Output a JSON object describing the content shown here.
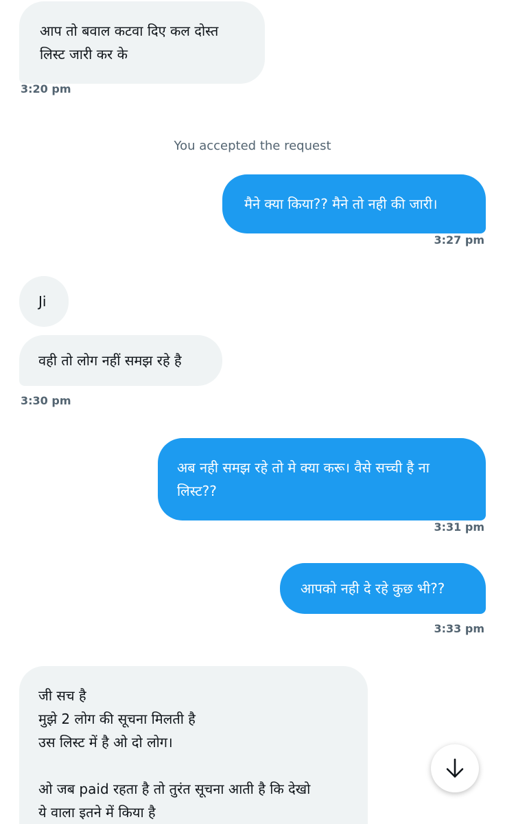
{
  "messages": [
    {
      "text": "आप तो बवाल कटवा दिए कल दोस्त\nलिस्ट जारी कर के"
    },
    {
      "text": "मैने क्या किया?? मैने तो नही की जारी।"
    },
    {
      "text": "Ji"
    },
    {
      "text": "वही तो लोग नहीं समझ रहे है"
    },
    {
      "text": "अब नही समझ रहे तो मे क्या करू। वैसे सच्ची है ना\nलिस्ट??"
    },
    {
      "text": "आपको नही दे रहे कुछ भी??"
    },
    {
      "text": "जी सच है\nमुझे 2 लोग की सूचना मिलती है\n उस लिस्ट में है ओ दो लोग।\n\nओ जब paid रहता है तो तुरंत सूचना आती है कि देखो\nये वाला इतने में किया है"
    }
  ],
  "timestamps": [
    "3:20 pm",
    "3:27 pm",
    "3:30 pm",
    "3:31 pm",
    "3:33 pm"
  ],
  "system_notice": "You accepted the request",
  "scroll_button": {
    "icon": "arrow-down-icon"
  },
  "colors": {
    "outgoing_bubble": "#1d9bf0",
    "incoming_bubble": "#eff3f4",
    "timestamp": "#536471"
  }
}
